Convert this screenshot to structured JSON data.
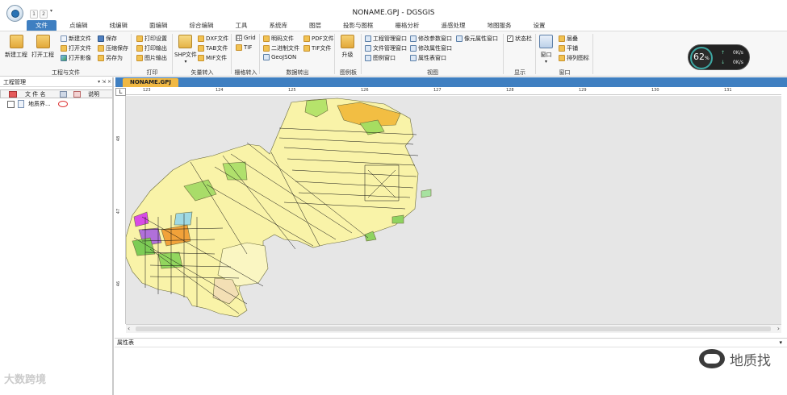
{
  "window": {
    "title": "NONAME.GPJ - DGSGIS"
  },
  "quick_access": [
    "1",
    "2"
  ],
  "tabs": [
    "文件",
    "点编辑",
    "线编辑",
    "面编辑",
    "综合编辑",
    "工具",
    "系统库",
    "图层",
    "投影与图框",
    "栅格分析",
    "遥感处理",
    "地图服务",
    "设置"
  ],
  "active_tab": "文件",
  "ribbon": {
    "project": {
      "label": "工程与文件",
      "new_project": "新建工程",
      "open_project": "打开工程",
      "new_file": "新建文件",
      "open_file": "打开文件",
      "open_image": "打开影像",
      "save": "保存",
      "compress_save": "压缩保存",
      "save_as": "另存为"
    },
    "print": {
      "label": "打印",
      "print_setup": "打印设置",
      "print_output": "打印输出",
      "image_output": "图片输出"
    },
    "vector_in": {
      "label": "矢量转入",
      "shp": "SHP文件",
      "dxf": "DXF文件",
      "tab": "TAB文件",
      "mif": "MIF文件"
    },
    "raster_in": {
      "label": "栅格转入",
      "grid": "Grid",
      "tif": "TIF"
    },
    "data_out": {
      "label": "数据转出",
      "mingjing": "明码文件",
      "binary": "二进制文件",
      "geojson": "GeoJSON",
      "pdf": "PDF文件",
      "tif": "TIF文件"
    },
    "legend": {
      "label": "图例板",
      "upgrade": "升级"
    },
    "view": {
      "label": "视图",
      "project_mgr": "工程管理窗口",
      "file_mgr": "文件管理窗口",
      "legend_win": "图例窗口",
      "edit_param": "修改参数窗口",
      "edit_attr": "修改属性窗口",
      "attr_table": "属性表窗口",
      "pixel_attr": "像元属性窗口"
    },
    "display": {
      "label": "显示",
      "status_bar": "状态栏"
    },
    "window": {
      "label": "窗口",
      "window_btn": "窗口",
      "cascade": "层叠",
      "tile": "平铺",
      "arrange": "排列图标"
    }
  },
  "gauge": {
    "percent": "62",
    "unit": "%",
    "up": "0K/s",
    "down": "0K/s"
  },
  "panel": {
    "title": "工程管理",
    "buttons": "▾ ⇲ ×",
    "col_name": "文 件 名",
    "col_desc": "说明",
    "layer_name": "地质界..."
  },
  "doc_tab": "NONAME.GPJ",
  "ruler": {
    "corner": "L",
    "h_ticks": [
      "123",
      "124",
      "125",
      "126",
      "127",
      "128",
      "129",
      "130",
      "131"
    ],
    "v_ticks": [
      "48",
      "47",
      "46"
    ]
  },
  "attr_panel": {
    "title": "属性表",
    "arrow": "▾"
  },
  "watermarks": {
    "left": "大数跨境",
    "right": "地质找"
  },
  "colors": {
    "accent": "#3f7fc1",
    "doc_tab": "#f0b843",
    "map_fill": "#f9f3a8"
  }
}
